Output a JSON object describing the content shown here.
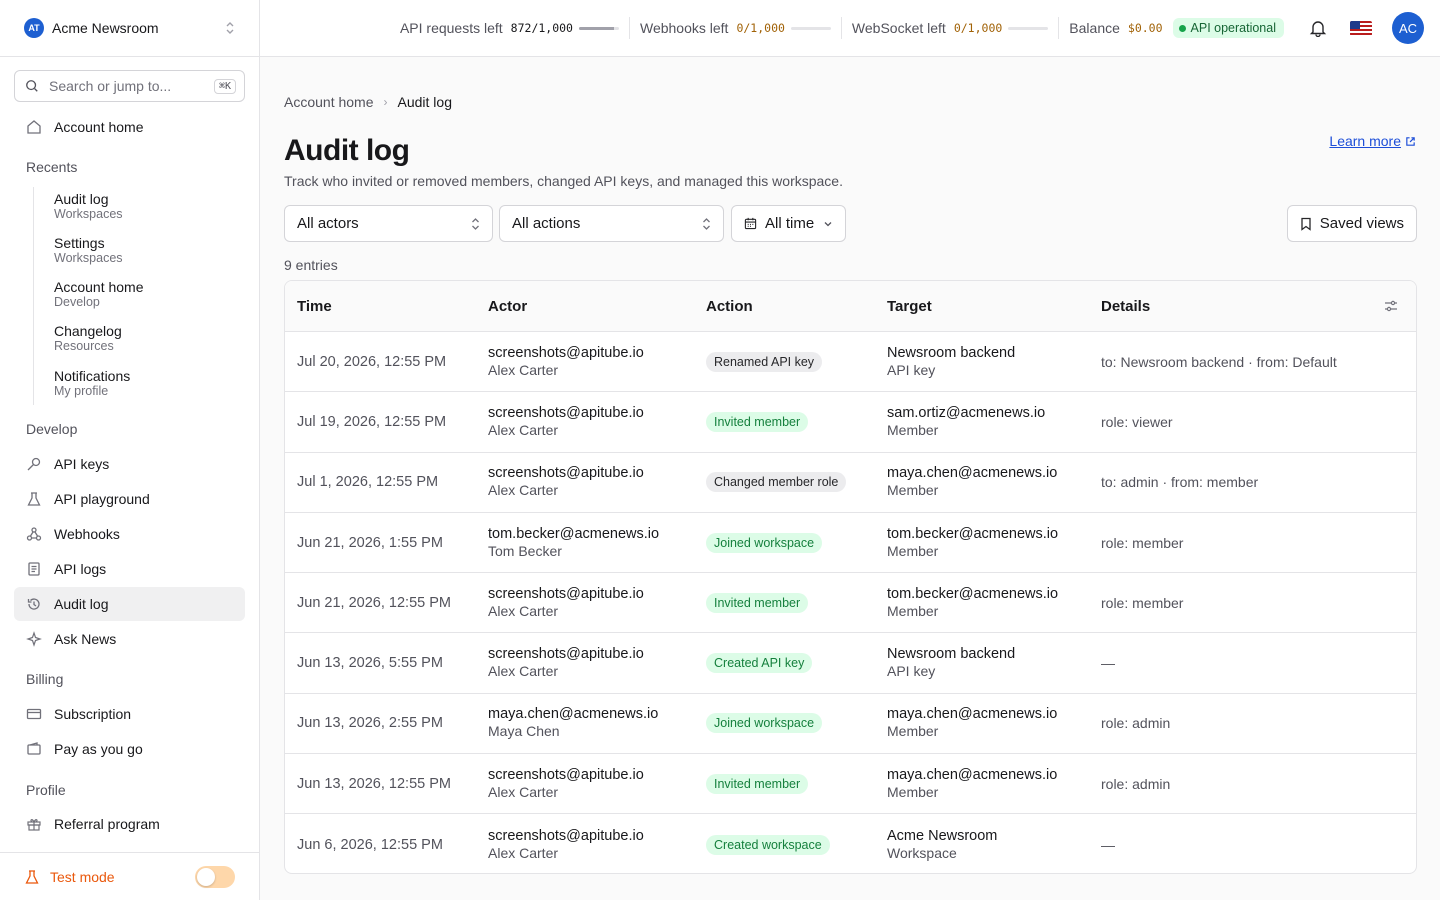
{
  "workspace": {
    "logo": "AT",
    "name": "Acme Newsroom"
  },
  "search": {
    "placeholder": "Search or jump to...",
    "shortcut": "⌘K"
  },
  "sidebar": {
    "home": "Account home",
    "recents_label": "Recents",
    "recents": [
      {
        "title": "Audit log",
        "sub": "Workspaces"
      },
      {
        "title": "Settings",
        "sub": "Workspaces"
      },
      {
        "title": "Account home",
        "sub": "Develop"
      },
      {
        "title": "Changelog",
        "sub": "Resources"
      },
      {
        "title": "Notifications",
        "sub": "My profile"
      }
    ],
    "develop_label": "Develop",
    "develop": [
      "API keys",
      "API playground",
      "Webhooks",
      "API logs",
      "Audit log",
      "Ask News"
    ],
    "billing_label": "Billing",
    "billing": [
      "Subscription",
      "Pay as you go"
    ],
    "profile_label": "Profile",
    "profile": [
      "Referral program"
    ],
    "test_mode": "Test mode"
  },
  "topbar": {
    "api_requests": {
      "label": "API requests left",
      "value": "872/1,000",
      "fraction": 0.872
    },
    "webhooks": {
      "label": "Webhooks left",
      "value": "0/1,000",
      "fraction": 0
    },
    "websocket": {
      "label": "WebSocket left",
      "value": "0/1,000",
      "fraction": 0
    },
    "balance": {
      "label": "Balance",
      "value": "$0.00"
    },
    "status": "API operational",
    "avatar": "AC"
  },
  "breadcrumb": {
    "parent": "Account home",
    "current": "Audit log"
  },
  "page": {
    "title": "Audit log",
    "description": "Track who invited or removed members, changed API keys, and managed this workspace.",
    "learn_more": "Learn more"
  },
  "filters": {
    "actors": "All actors",
    "actions": "All actions",
    "time": "All time",
    "saved_views": "Saved views"
  },
  "entry_count": "9 entries",
  "table": {
    "columns": [
      "Time",
      "Actor",
      "Action",
      "Target",
      "Details"
    ],
    "rows": [
      {
        "time": "Jul 20, 2026, 12:55 PM",
        "actor_email": "screenshots@apitube.io",
        "actor_name": "Alex Carter",
        "action": "Renamed API key",
        "action_style": "gray",
        "target": "Newsroom backend",
        "target_type": "API key",
        "details": "to: Newsroom backend · from: Default"
      },
      {
        "time": "Jul 19, 2026, 12:55 PM",
        "actor_email": "screenshots@apitube.io",
        "actor_name": "Alex Carter",
        "action": "Invited member",
        "action_style": "green",
        "target": "sam.ortiz@acmenews.io",
        "target_type": "Member",
        "details": "role: viewer"
      },
      {
        "time": "Jul 1, 2026, 12:55 PM",
        "actor_email": "screenshots@apitube.io",
        "actor_name": "Alex Carter",
        "action": "Changed member role",
        "action_style": "gray",
        "target": "maya.chen@acmenews.io",
        "target_type": "Member",
        "details": "to: admin · from: member"
      },
      {
        "time": "Jun 21, 2026, 1:55 PM",
        "actor_email": "tom.becker@acmenews.io",
        "actor_name": "Tom Becker",
        "action": "Joined workspace",
        "action_style": "green",
        "target": "tom.becker@acmenews.io",
        "target_type": "Member",
        "details": "role: member"
      },
      {
        "time": "Jun 21, 2026, 12:55 PM",
        "actor_email": "screenshots@apitube.io",
        "actor_name": "Alex Carter",
        "action": "Invited member",
        "action_style": "green",
        "target": "tom.becker@acmenews.io",
        "target_type": "Member",
        "details": "role: member"
      },
      {
        "time": "Jun 13, 2026, 5:55 PM",
        "actor_email": "screenshots@apitube.io",
        "actor_name": "Alex Carter",
        "action": "Created API key",
        "action_style": "green",
        "target": "Newsroom backend",
        "target_type": "API key",
        "details": "—"
      },
      {
        "time": "Jun 13, 2026, 2:55 PM",
        "actor_email": "maya.chen@acmenews.io",
        "actor_name": "Maya Chen",
        "action": "Joined workspace",
        "action_style": "green",
        "target": "maya.chen@acmenews.io",
        "target_type": "Member",
        "details": "role: admin"
      },
      {
        "time": "Jun 13, 2026, 12:55 PM",
        "actor_email": "screenshots@apitube.io",
        "actor_name": "Alex Carter",
        "action": "Invited member",
        "action_style": "green",
        "target": "maya.chen@acmenews.io",
        "target_type": "Member",
        "details": "role: admin"
      },
      {
        "time": "Jun 6, 2026, 12:55 PM",
        "actor_email": "screenshots@apitube.io",
        "actor_name": "Alex Carter",
        "action": "Created workspace",
        "action_style": "green",
        "target": "Acme Newsroom",
        "target_type": "Workspace",
        "details": "—"
      }
    ]
  }
}
